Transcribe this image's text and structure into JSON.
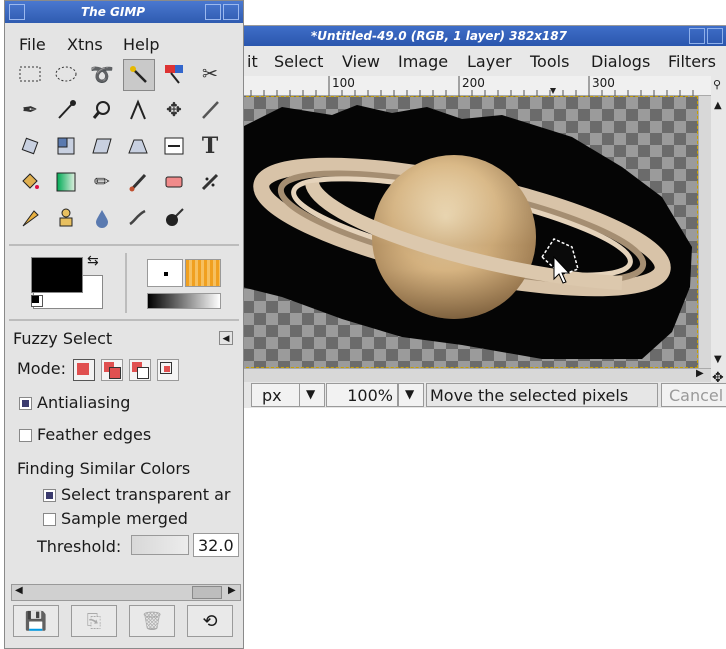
{
  "toolbox": {
    "title": "The GIMP",
    "menu": [
      "File",
      "Xtns",
      "Help"
    ],
    "tools_row1": [
      "rect-select-icon",
      "ellipse-select-icon",
      "lasso-icon",
      "fuzzy-select-icon",
      "color-select-icon",
      "scissors-icon"
    ],
    "tools_row2": [
      "paths-icon",
      "color-picker-icon",
      "zoom-icon",
      "measure-icon",
      "move-icon",
      "crop-knife-icon"
    ],
    "tools_row3": [
      "rotate-icon",
      "scale-icon",
      "shear-icon",
      "perspective-icon",
      "flip-icon",
      "text-icon"
    ],
    "tools_row4": [
      "bucket-fill-icon",
      "blend-icon",
      "pencil-icon",
      "paintbrush-icon",
      "eraser-icon",
      "airbrush-icon"
    ],
    "tools_row5": [
      "ink-icon",
      "clone-icon",
      "blur-icon",
      "smudge-icon",
      "dodge-burn-icon"
    ],
    "text_tool_glyph": "T",
    "colors": {
      "foreground": "#000000",
      "background": "#ffffff"
    }
  },
  "tool_options": {
    "title": "Fuzzy Select",
    "mode_label": "Mode:",
    "antialiasing": {
      "label": "Antialiasing",
      "checked": true
    },
    "feather": {
      "label": "Feather edges",
      "checked": false
    },
    "section": "Finding Similar Colors",
    "select_transparent": {
      "label": "Select transparent ar",
      "checked": true
    },
    "sample_merged": {
      "label": "Sample merged",
      "checked": false
    },
    "threshold": {
      "label": "Threshold:",
      "value": "32.0"
    }
  },
  "image_window": {
    "title": "*Untitled-49.0 (RGB, 1 layer) 382x187",
    "menu": [
      "it",
      "Select",
      "View",
      "Image",
      "Layer",
      "Tools",
      "Dialogs",
      "Filters"
    ],
    "ruler": [
      "100",
      "200",
      "300"
    ],
    "status": {
      "unit": "px",
      "zoom": "100%",
      "message": "Move the selected pixels",
      "cancel": "Cancel"
    }
  }
}
